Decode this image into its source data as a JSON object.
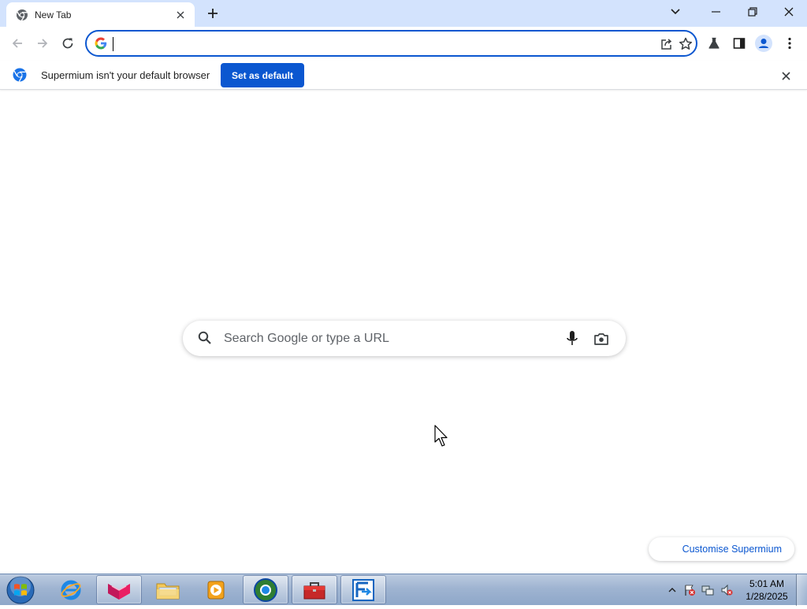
{
  "tab": {
    "title": "New Tab",
    "favicon": "chrome-icon"
  },
  "toolbar": {
    "back": "back-arrow-icon",
    "forward": "forward-arrow-icon",
    "reload": "reload-icon",
    "omnibox": {
      "value": "",
      "placeholder": ""
    },
    "share": "share-icon",
    "bookmark": "star-icon",
    "labs": "flask-icon",
    "sidepanel": "side-panel-icon",
    "profile": "profile-icon",
    "menu": "kebab-menu-icon"
  },
  "infobar": {
    "message": "Supermium isn't your default browser",
    "button_label": "Set as default"
  },
  "ntp": {
    "search_placeholder": "Search Google or type a URL",
    "customise_label": "Customise Supermium"
  },
  "taskbar": {
    "clock_time": "5:01 AM",
    "clock_date": "1/28/2025",
    "items": [
      {
        "name": "internet-explorer"
      },
      {
        "name": "app-pink-icon"
      },
      {
        "name": "file-explorer"
      },
      {
        "name": "media-player"
      },
      {
        "name": "supermium-browser"
      },
      {
        "name": "toolbox-app"
      },
      {
        "name": "file-transfer-app"
      }
    ]
  },
  "colors": {
    "tabstrip": "#d3e3fd",
    "accent": "#0b57d0",
    "link": "#0b57d0"
  }
}
